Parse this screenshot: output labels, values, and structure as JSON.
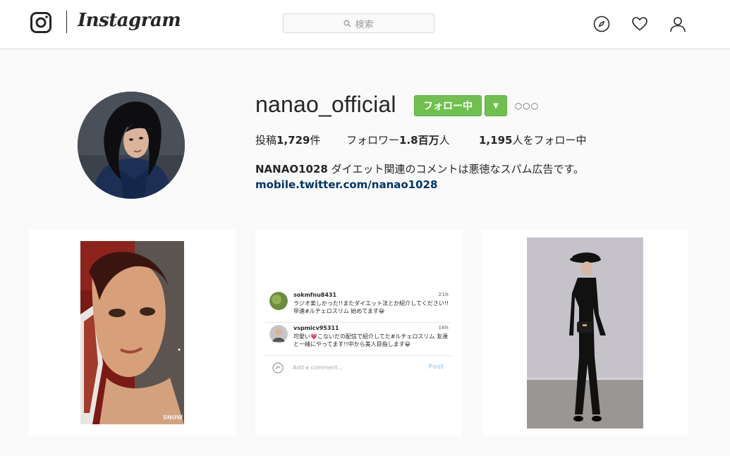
{
  "header": {
    "brand": "Instagram",
    "search_placeholder": "検索",
    "nav_icons": [
      "compass-icon",
      "heart-icon",
      "person-icon"
    ]
  },
  "profile": {
    "username": "nanao_official",
    "follow_label": "フォロー中",
    "stats": {
      "posts_prefix": "投稿",
      "posts_value": "1,729",
      "posts_suffix": "件",
      "followers_prefix": "フォロワー",
      "followers_value": "1.8百万",
      "followers_suffix": "人",
      "following_value": "1,195",
      "following_suffix": "人をフォロー中"
    },
    "bio_name": "NANAO1028",
    "bio_text": " ダイエット関連のコメントは悪徳なスパム広告です。",
    "bio_link": "mobile.twitter.com/nanao1028"
  },
  "posts": [
    {
      "type": "video",
      "watermark": "SNOW"
    },
    {
      "type": "comments-screenshot",
      "comments": [
        {
          "user": "sokmfnu8431",
          "time": "21h",
          "text": "ラジオ楽しかった!!またダイエット法とか紹介してください!!早速#ルチェロスリム 始めてます😀"
        },
        {
          "user": "vspmicv95311",
          "time": "16h",
          "text": "可愛い💗こないだの配信で紹介してた#ルチェロスリム 友達と一緒にやってます!!中から美人目指します😀"
        }
      ],
      "add_comment_placeholder": "Add a comment...",
      "post_label": "Post"
    },
    {
      "type": "photo"
    }
  ],
  "colors": {
    "follow_green": "#70c050",
    "link_blue": "#003569",
    "border": "#dbdbdb",
    "background": "#fafafa"
  }
}
